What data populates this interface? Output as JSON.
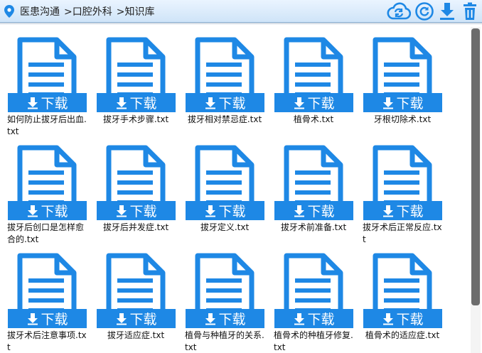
{
  "breadcrumb": {
    "items": [
      "医患沟通",
      ">口腔外科",
      ">知识库"
    ]
  },
  "toolbar": {
    "icons": [
      "cloud-sync-icon",
      "refresh-icon",
      "download-icon",
      "trash-icon"
    ]
  },
  "download_label": "下载",
  "colors": {
    "accent": "#1e88e5",
    "header_start": "#eaf4ff",
    "header_end": "#cfe4f8"
  },
  "files": [
    {
      "name": "如何防止拔牙后出血.txt"
    },
    {
      "name": "拔牙手术步骤.txt"
    },
    {
      "name": "拔牙相对禁忌症.txt"
    },
    {
      "name": "植骨术.txt"
    },
    {
      "name": "牙根切除术.txt"
    },
    {
      "name": "拔牙后创口是怎样愈合的.txt"
    },
    {
      "name": "拔牙后并发症.txt"
    },
    {
      "name": "拔牙定义.txt"
    },
    {
      "name": "拔牙术前准备.txt"
    },
    {
      "name": "拔牙术后正常反应.txt"
    },
    {
      "name": "拔牙术后注意事项.txt"
    },
    {
      "name": "拔牙适应症.txt"
    },
    {
      "name": "植骨与种植牙的关系.txt"
    },
    {
      "name": "植骨术的种植牙修复.txt"
    },
    {
      "name": "植骨术的适应症.txt"
    }
  ]
}
